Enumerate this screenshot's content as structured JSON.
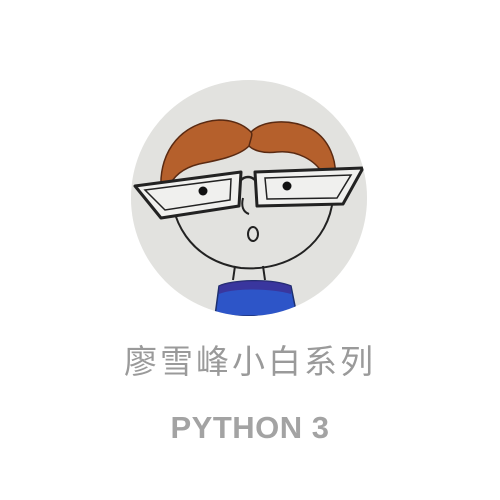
{
  "header": {
    "title": "廖雪峰小白系列",
    "subtitle": "PYTHON 3"
  },
  "avatar": {
    "icon": "cartoon-face-with-glasses-icon"
  },
  "colors": {
    "background": "#ffffff",
    "avatar_bg": "#e6e6e3",
    "hair": "#b5602c",
    "shirt": "#2d55c8",
    "text": "#9a9a9a"
  }
}
